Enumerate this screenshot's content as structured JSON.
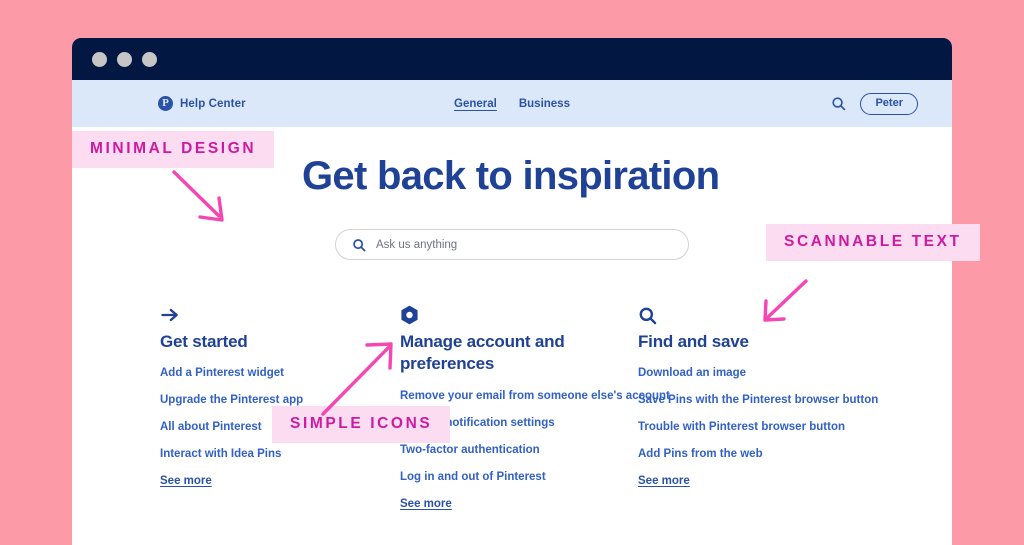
{
  "theme": {
    "page_bg": "#fc9aa8",
    "chrome_bg": "#021842",
    "header_bg": "#dbe8f9",
    "brand_blue": "#2a52a5",
    "headline_blue": "#1f4196",
    "link_blue": "#3261c4",
    "anno_bg": "#fbdcf0",
    "anno_fg": "#cc1ba0",
    "arrow_pink": "#f546b4"
  },
  "browser": {
    "traffic_lights": [
      "close-dot",
      "minimize-dot",
      "maximize-dot"
    ]
  },
  "header": {
    "logo_glyph": "P",
    "logo_icon": "pinterest-logo-icon",
    "brand": "Help Center",
    "nav": [
      {
        "label": "General",
        "active": true
      },
      {
        "label": "Business",
        "active": false
      }
    ],
    "search_icon": "search-icon",
    "user": "Peter"
  },
  "hero": {
    "headline": "Get back to inspiration",
    "search": {
      "icon": "search-icon",
      "placeholder": "Ask us anything",
      "value": ""
    }
  },
  "columns": [
    {
      "icon": "arrow-right-icon",
      "title": "Get started",
      "links": [
        "Add a Pinterest widget",
        "Upgrade the Pinterest app",
        "All about Pinterest",
        "Interact with Idea Pins"
      ],
      "see_more": "See more"
    },
    {
      "icon": "hexagon-gear-icon",
      "title": "Manage account and preferences",
      "links": [
        "Remove your email from someone else's account",
        "Change notification settings",
        "Two-factor authentication",
        "Log in and out of Pinterest"
      ],
      "see_more": "See more"
    },
    {
      "icon": "search-icon",
      "title": "Find and save",
      "links": [
        "Download an image",
        "Save Pins with the Pinterest browser button",
        "Trouble with Pinterest browser button",
        "Add Pins from the web"
      ],
      "see_more": "See more"
    }
  ],
  "annotations": [
    {
      "label": "MINIMAL DESIGN",
      "arrow": "arrow-down-right"
    },
    {
      "label": "SCANNABLE TEXT",
      "arrow": "arrow-down-left"
    },
    {
      "label": "SIMPLE ICONS",
      "arrow": "arrow-up-right"
    }
  ]
}
